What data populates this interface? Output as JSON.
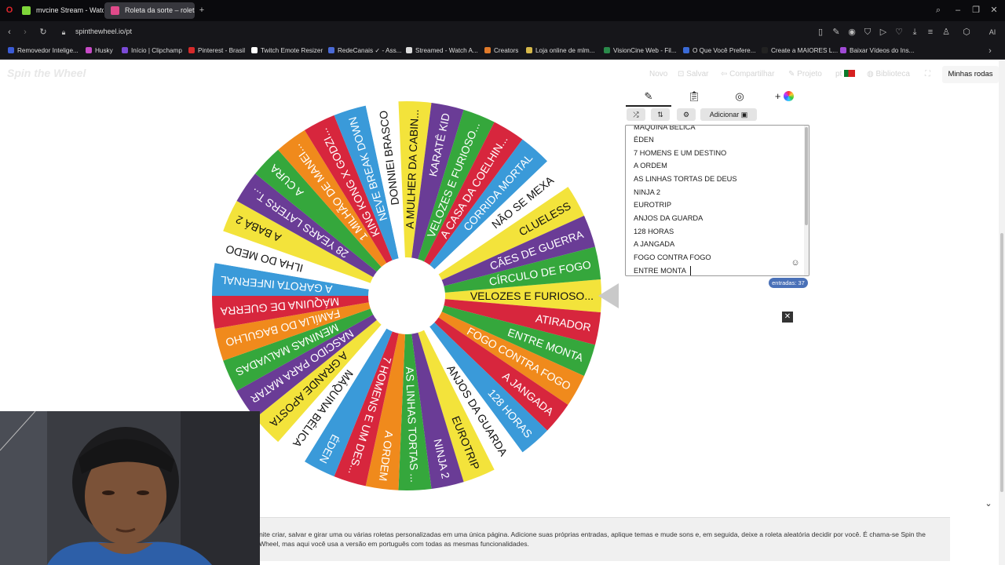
{
  "browser": {
    "tabs": [
      {
        "title": "mvcine Stream - Watch L",
        "active": false,
        "favicon_color": "#7fd63a"
      },
      {
        "title": "Roleta da sorte – roleta c",
        "active": true,
        "favicon_color": "#e04a8a"
      }
    ],
    "url": "spinthewheel.io/pt",
    "bookmarks": [
      {
        "label": "Removedor Intelige...",
        "color": "#3b5bd6"
      },
      {
        "label": "Husky",
        "color": "#c74ac7"
      },
      {
        "label": "Início | Clipchamp",
        "color": "#7a4ad6"
      },
      {
        "label": "Pinterest - Brasil",
        "color": "#d62a2a"
      },
      {
        "label": "Twitch Emote Resizer",
        "color": "#ffffff"
      },
      {
        "label": "RedeCanais ✓ - Ass...",
        "color": "#4a6ad6"
      },
      {
        "label": "Streamed - Watch A...",
        "color": "#dddddd"
      },
      {
        "label": "Creators",
        "color": "#e07a2a"
      },
      {
        "label": "Loja online de mlm...",
        "color": "#d6b84a"
      },
      {
        "label": "VisionCine Web - Fil...",
        "color": "#2a8a4a"
      },
      {
        "label": "O Que Você Prefere...",
        "color": "#3a6ad6"
      },
      {
        "label": "Create a MAIORES L...",
        "color": "#222222"
      },
      {
        "label": "Baixar Vídeos do Ins...",
        "color": "#a04ad6"
      }
    ]
  },
  "app": {
    "logo": "Spin the Wheel",
    "menu": [
      "Novo",
      "Salvar",
      "Compartilhar",
      "Projeto",
      "pt",
      "Biblioteca"
    ],
    "my_wheels": "Minhas rodas",
    "add_label": "Adicionar",
    "entries_count": "entradas: 37",
    "entries_visible": [
      "MÁQUINA BÉLICA",
      "ÉDEN",
      "7 HOMENS E UM DESTINO",
      "A ORDEM",
      "AS LINHAS TORTAS DE DEUS",
      "NINJA 2",
      "EUROTRIP",
      "ANJOS DA GUARDA",
      "128 HORAS",
      "A JANGADA",
      "FOGO CONTRA FOGO",
      "ENTRE MONTA"
    ],
    "footer_text": "nite criar, salvar e girar uma ou várias roletas personalizadas em uma única página. Adicione suas próprias entradas, aplique temas e mude sons e, em seguida, deixe a roleta aleatória decidir por você. É chama-se Spin the Wheel, mas aqui você usa a versão em português com todas as mesmas funcionalidades."
  },
  "wheel": {
    "colors": {
      "blue": "#3a9ad9",
      "green": "#35a73c",
      "red": "#d7263d",
      "orange": "#f08a1c",
      "purple": "#6a3c96",
      "yellow": "#f3e33b",
      "white": "#ffffff"
    },
    "segments": [
      {
        "label": "VELOZES E FURIOSO...",
        "color": "yellow"
      },
      {
        "label": "ATIRADOR",
        "color": "red"
      },
      {
        "label": "ENTRE MONTA",
        "color": "green"
      },
      {
        "label": "FOGO CONTRA FOGO",
        "color": "orange"
      },
      {
        "label": "A JANGADA",
        "color": "red"
      },
      {
        "label": "128 HORAS",
        "color": "blue"
      },
      {
        "label": "ANJOS DA GUARDA",
        "color": "white"
      },
      {
        "label": "EUROTRIP",
        "color": "yellow"
      },
      {
        "label": "NINJA 2",
        "color": "purple"
      },
      {
        "label": "AS LINHAS TORTAS ...",
        "color": "green"
      },
      {
        "label": "A ORDEM",
        "color": "orange"
      },
      {
        "label": "7 HOMENS E UM DES...",
        "color": "red"
      },
      {
        "label": "ÉDEN",
        "color": "blue"
      },
      {
        "label": "MÁQUINA BÉLICA",
        "color": "white"
      },
      {
        "label": "A GRANDE APOSTA",
        "color": "yellow"
      },
      {
        "label": "NASCIDO PARA MATAR",
        "color": "purple"
      },
      {
        "label": "MENINAS MALVADAS",
        "color": "green"
      },
      {
        "label": "FAMÍLIA DO BAGULHO",
        "color": "orange"
      },
      {
        "label": "MÁQUINA DE GUERRA",
        "color": "red"
      },
      {
        "label": "A GAROTA INFERNAL",
        "color": "blue"
      },
      {
        "label": "ILHA DO MEDO",
        "color": "white"
      },
      {
        "label": "A BABÁ 2",
        "color": "yellow"
      },
      {
        "label": "28 YEARS LATERS T...",
        "color": "purple"
      },
      {
        "label": "A CURA",
        "color": "green"
      },
      {
        "label": "1 MILHÃO DE MANEI...",
        "color": "orange"
      },
      {
        "label": "KING KONG X GODZI...",
        "color": "red"
      },
      {
        "label": "NEVE BREAK DOWN",
        "color": "blue"
      },
      {
        "label": "DONNIEI BRASCO",
        "color": "white"
      },
      {
        "label": "A MULHER DA CABIN...",
        "color": "yellow"
      },
      {
        "label": "KARATÊ KID",
        "color": "purple"
      },
      {
        "label": "VELOZES E FURIOSO...",
        "color": "green"
      },
      {
        "label": "A CASA DA COELHIN...",
        "color": "red"
      },
      {
        "label": "CORRIDA MORTAL",
        "color": "blue"
      },
      {
        "label": "NÃO SE MEXA",
        "color": "white"
      },
      {
        "label": "CLUELESS",
        "color": "yellow"
      },
      {
        "label": "CÃES DE GUERRA",
        "color": "purple"
      },
      {
        "label": "CÍRCULO DE FOGO",
        "color": "green"
      }
    ]
  }
}
